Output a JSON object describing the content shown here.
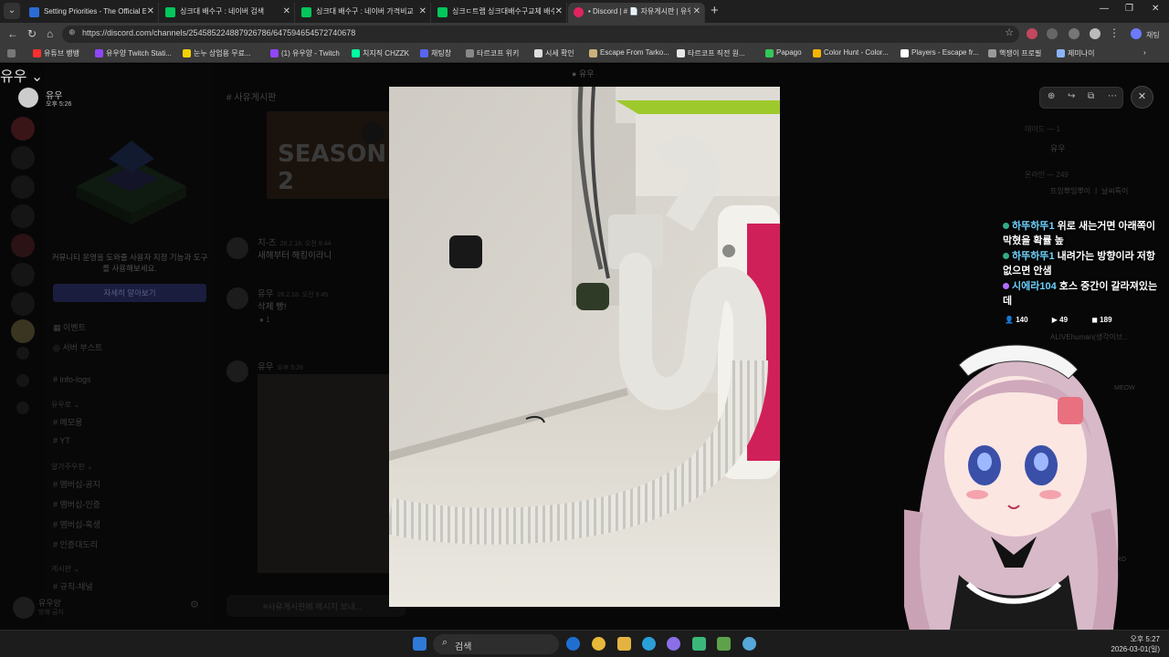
{
  "browser": {
    "tabs": [
      {
        "label": "Setting Priorities - The Official Esc",
        "color": "#2b6cd4"
      },
      {
        "label": "싱크대 배수구 : 네이버 검색",
        "color": "#03c75a"
      },
      {
        "label": "싱크대 배수구 : 네이버 가격비교",
        "color": "#03c75a"
      },
      {
        "label": "싱크ㄷ트랩 싱크대배수구교체 배수구",
        "color": "#03c75a"
      },
      {
        "label": "• Discord | # 📄 자유게시판 | 유우",
        "color": "#e0245e"
      }
    ],
    "new_tab": "+",
    "window_controls": [
      "—",
      "❐",
      "✕"
    ],
    "url": "https://discord.com/channels/254585224887926786/647594654572740678",
    "chat_button": "채팅",
    "bookmarks": [
      {
        "label": "유튜브 뱅뱅",
        "color": "#ff3030"
      },
      {
        "label": "유우양 Twitch Stati...",
        "color": "#9146ff"
      },
      {
        "label": "눈누 상업용 무료...",
        "color": "#f3d000"
      },
      {
        "label": "(1) 유우양 - Twitch",
        "color": "#9146ff"
      },
      {
        "label": "치지직 CHZZK",
        "color": "#00ffa3"
      },
      {
        "label": "채팅창",
        "color": "#5865f2"
      },
      {
        "label": "타르코프 위키",
        "color": "#888888"
      },
      {
        "label": "시세 확인",
        "color": "#dddddd"
      },
      {
        "label": "Escape From Tarko...",
        "color": "#c9b27a"
      },
      {
        "label": "타르코프 직전 원...",
        "color": "#e8e8e8"
      },
      {
        "label": "Papago",
        "color": "#34c759"
      },
      {
        "label": "Color Hunt - Color...",
        "color": "#f5b400"
      },
      {
        "label": "Players - Escape fr...",
        "color": "#ffffff"
      },
      {
        "label": "핵쟁이 프로필",
        "color": "#999999"
      },
      {
        "label": "제미나이",
        "color": "#8ab4f8"
      }
    ]
  },
  "discord": {
    "server": {
      "name": "유우",
      "status": "오후 5:26"
    },
    "server_title": "유우",
    "channel_header": "사유게시판",
    "promo": {
      "text": "커뮤니티 운영을 도와줄 사용자 지정 기능과 도구를 사용해보세요.",
      "button": "자세히 알아보기"
    },
    "channels": [
      "이벤트",
      "서버 부스트",
      "info-logs"
    ],
    "categories": [
      {
        "name": "유우로",
        "channels": [
          "메모용",
          "YT"
        ]
      },
      {
        "name": "알가주우판",
        "channels": [
          "멤버십-공지",
          "멤버십-인증",
          "멤버십-혹생",
          "인증대도리"
        ]
      },
      {
        "name": "게시판",
        "channels": [
          "규칙-채널"
        ]
      }
    ],
    "messages": [
      {
        "author": "치-즈",
        "time": "26.2.18. 오전 9:44",
        "text": "새해부터 해킹이라니"
      },
      {
        "author": "유우",
        "time": "26.2.18. 오전 9:45",
        "text": "삭제 빵!",
        "reaction_count": "1"
      },
      {
        "author": "유우",
        "time": "오후 5:26",
        "text": ""
      }
    ],
    "composer_placeholder": "#사유게시판에 메시지 보내...",
    "user": {
      "name": "유우양",
      "status": "방해 금지"
    },
    "members": {
      "groups": [
        {
          "label": "데이드 — 1",
          "members": [
            "유우"
          ]
        },
        {
          "label": "온라인 — 249",
          "members": [
            "뜨잉뿌잉뿌이 ㅣ 날씨특이",
            "ALIVEhuman(생각이브...",
            "MEOW",
            "DORO"
          ]
        }
      ]
    }
  },
  "lightbox": {
    "title": "유우",
    "tools": [
      "zoom-in-icon",
      "share-icon",
      "open-external-icon",
      "more-icon"
    ],
    "close": "✕"
  },
  "stream_chat": [
    {
      "name": "하뚜하뚜1",
      "text": "위로 새는거면 아래쪽이 막혔을 확률 높"
    },
    {
      "name": "하뚜하뚜1",
      "text": "내려가는 방향이라 저항 없으면 안샘"
    },
    {
      "name": "시에라104",
      "text": "호스 중간이 갈라져있는데"
    }
  ],
  "stream_stats": {
    "viewers": "140",
    "yt": "49",
    "other": "189"
  },
  "taskbar": {
    "search_placeholder": "검색",
    "time": "오후 5:27",
    "date": "2026-03-01(일)"
  }
}
